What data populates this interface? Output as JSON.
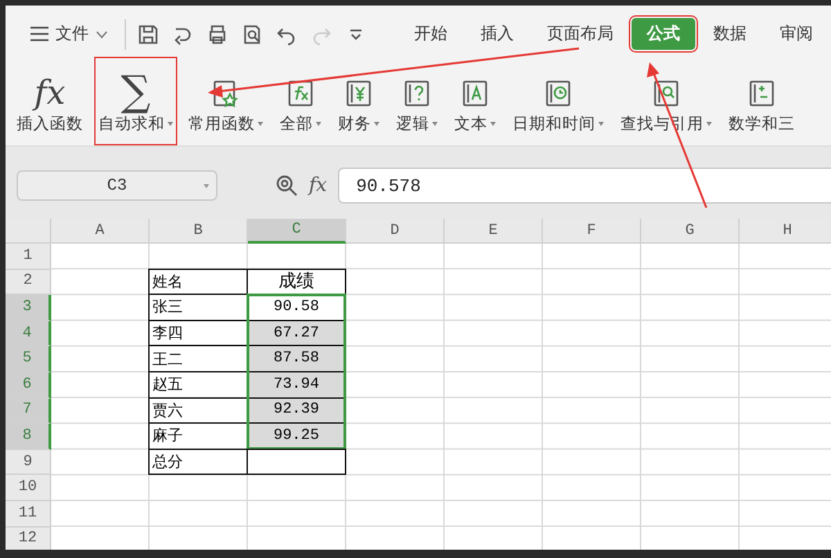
{
  "menu": {
    "label": "文件"
  },
  "quick_tools": [
    {
      "kind": "save",
      "disabled": false
    },
    {
      "kind": "export",
      "disabled": false
    },
    {
      "kind": "print",
      "disabled": false
    },
    {
      "kind": "preview",
      "disabled": false
    },
    {
      "kind": "undo",
      "disabled": false
    },
    {
      "kind": "redo",
      "disabled": true
    },
    {
      "kind": "more",
      "disabled": false
    }
  ],
  "tabs": [
    {
      "label": "开始",
      "selected": false,
      "highlighted": false
    },
    {
      "label": "插入",
      "selected": false,
      "highlighted": false
    },
    {
      "label": "页面布局",
      "selected": false,
      "highlighted": false
    },
    {
      "label": "公式",
      "selected": true,
      "highlighted": true
    },
    {
      "label": "数据",
      "selected": false,
      "highlighted": false
    },
    {
      "label": "审阅",
      "selected": false,
      "highlighted": false
    }
  ],
  "ribbon": [
    {
      "label": "插入函数",
      "kind": "glyph",
      "glyph": "fx",
      "dropdown": false,
      "highlighted": false
    },
    {
      "label": "自动求和",
      "kind": "glyph",
      "glyph": "∑",
      "dropdown": true,
      "highlighted": true
    },
    {
      "label": "常用函数",
      "kind": "star",
      "dropdown": true,
      "highlighted": false
    },
    {
      "label": "全部",
      "kind": "fx",
      "dropdown": true,
      "highlighted": false
    },
    {
      "label": "财务",
      "kind": "yen",
      "dropdown": true,
      "highlighted": false
    },
    {
      "label": "逻辑",
      "kind": "question",
      "dropdown": true,
      "highlighted": false
    },
    {
      "label": "文本",
      "kind": "letter",
      "dropdown": true,
      "highlighted": false
    },
    {
      "label": "日期和时间",
      "kind": "clock",
      "dropdown": true,
      "highlighted": false
    },
    {
      "label": "查找与引用",
      "kind": "lookup",
      "dropdown": true,
      "highlighted": false
    },
    {
      "label": "数学和三",
      "kind": "math",
      "dropdown": false,
      "highlighted": false
    }
  ],
  "name_box": "C3",
  "formula_glyph": "fx",
  "formula": "90.578",
  "columns": [
    {
      "label": "A",
      "selected": false
    },
    {
      "label": "B",
      "selected": false
    },
    {
      "label": "C",
      "selected": true
    },
    {
      "label": "D",
      "selected": false
    },
    {
      "label": "E",
      "selected": false
    },
    {
      "label": "F",
      "selected": false
    },
    {
      "label": "G",
      "selected": false
    },
    {
      "label": "H",
      "selected": false
    }
  ],
  "rows": [
    {
      "header": "1",
      "selected": false,
      "in_table": false
    },
    {
      "header": "2",
      "selected": false,
      "in_table": true,
      "name": "姓名",
      "score": "成绩",
      "score_selected": false,
      "active": false
    },
    {
      "header": "3",
      "selected": true,
      "in_table": true,
      "name": "张三",
      "score": "90.58",
      "score_selected": true,
      "active": true
    },
    {
      "header": "4",
      "selected": true,
      "in_table": true,
      "name": "李四",
      "score": "67.27",
      "score_selected": true,
      "active": false
    },
    {
      "header": "5",
      "selected": true,
      "in_table": true,
      "name": "王二",
      "score": "87.58",
      "score_selected": true,
      "active": false
    },
    {
      "header": "6",
      "selected": true,
      "in_table": true,
      "name": "赵五",
      "score": "73.94",
      "score_selected": true,
      "active": false
    },
    {
      "header": "7",
      "selected": true,
      "in_table": true,
      "name": "贾六",
      "score": "92.39",
      "score_selected": true,
      "active": false
    },
    {
      "header": "8",
      "selected": true,
      "in_table": true,
      "name": "麻子",
      "score": "99.25",
      "score_selected": true,
      "active": false
    },
    {
      "header": "9",
      "selected": false,
      "in_table": true,
      "name": "总分",
      "score_selected": false,
      "active": false
    },
    {
      "header": "10",
      "selected": false,
      "in_table": false
    },
    {
      "header": "11",
      "selected": false,
      "in_table": false
    },
    {
      "header": "12",
      "selected": false,
      "in_table": false
    }
  ]
}
